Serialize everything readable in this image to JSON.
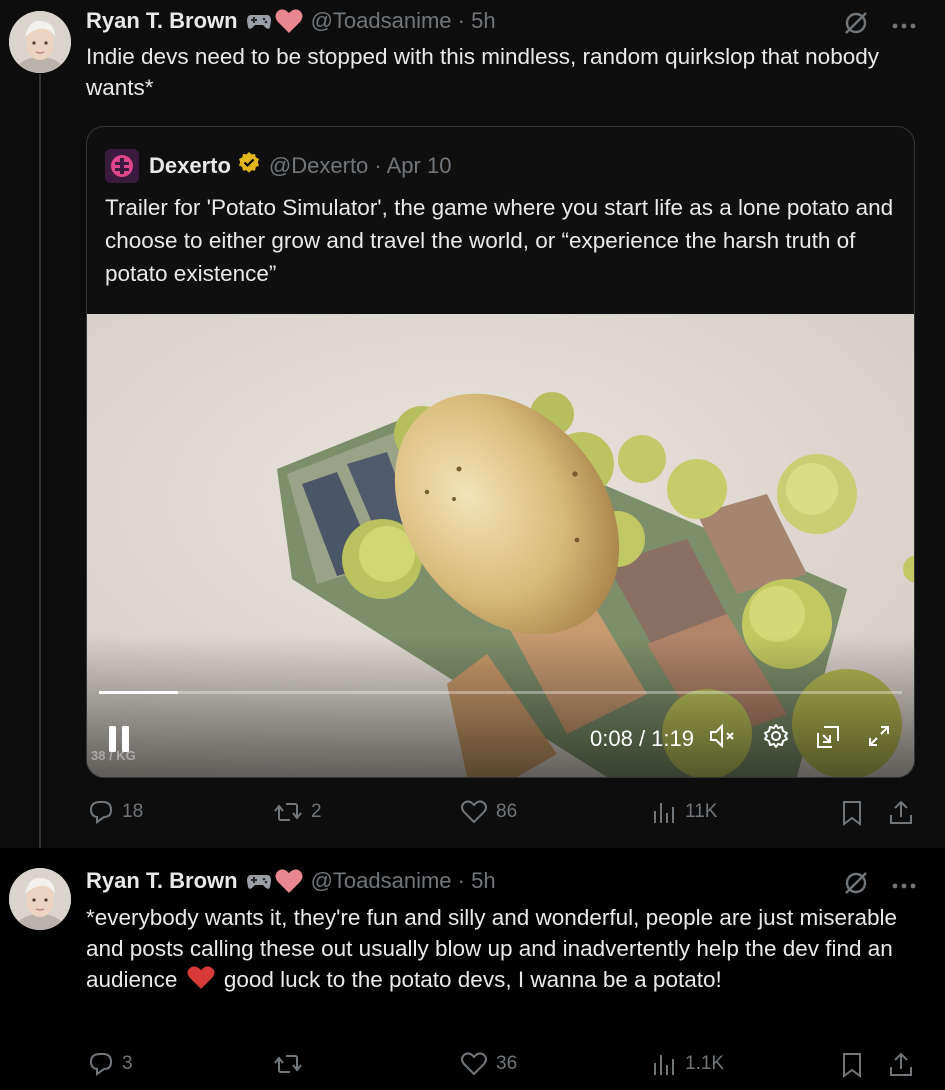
{
  "post1": {
    "author": "Ryan T. Brown",
    "handle_time": "@Toadsanime · 5h",
    "text": "Indie devs need to be stopped with this mindless, random quirkslop that nobody wants*",
    "quote": {
      "author": "Dexerto",
      "handle_time": "@Dexerto · Apr 10",
      "verified_color": "#e2b719",
      "text": "Trailer for 'Potato Simulator', the game where you start life as a lone potato and choose to either grow and travel the world, or “experience the harsh truth of potato existence”",
      "video": {
        "time": "0:08 / 1:19",
        "progress": 0.098,
        "overlay_label": "38 / KG"
      }
    },
    "actions": {
      "replies": "18",
      "reposts": "2",
      "likes": "86",
      "views": "11K"
    }
  },
  "post2": {
    "author": "Ryan T. Brown",
    "handle_time": "@Toadsanime · 5h",
    "text_before_heart": "*everybody wants it, they're fun and silly and wonderful, people are just miserable and posts calling these out usually blow up and inadvertently help the dev find an audience",
    "text_after_heart": "good luck to the potato devs, I wanna be a potato!",
    "actions": {
      "replies": "3",
      "reposts": "",
      "likes": "36",
      "views": "1.1K"
    }
  },
  "colors": {
    "muted": "#71767b",
    "text": "#e7e9ea",
    "heart": "#e8878f",
    "red_heart": "#d83a3a"
  }
}
